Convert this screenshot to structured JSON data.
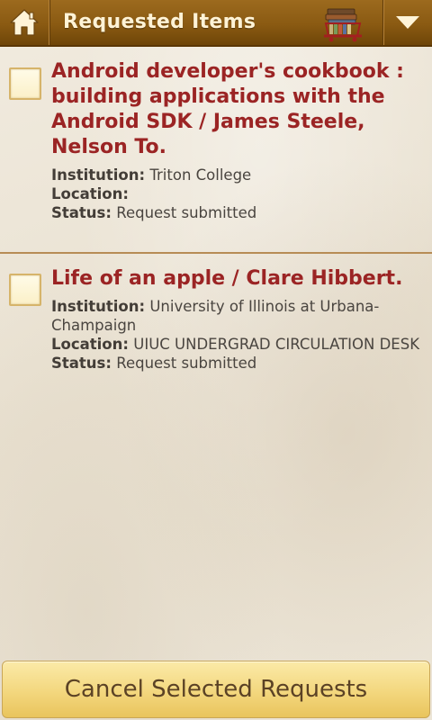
{
  "header": {
    "title": "Requested Items"
  },
  "items": [
    {
      "title": "Android developer's cookbook : building applications with the Android SDK / James Steele, Nelson To.",
      "institution_label": "Institution:",
      "institution": "Triton College",
      "location_label": "Location:",
      "location": "",
      "status_label": "Status:",
      "status": "Request submitted",
      "checked": false
    },
    {
      "title": "Life of an apple / Clare Hibbert.",
      "institution_label": "Institution:",
      "institution": "University of Illinois at Urbana-Champaign",
      "location_label": "Location:",
      "location": "UIUC UNDERGRAD CIRCULATION DESK",
      "status_label": "Status:",
      "status": "Request submitted",
      "checked": false
    }
  ],
  "footer": {
    "cancel_label": "Cancel Selected Requests"
  },
  "icons": {
    "home": "home-icon",
    "books": "books-icon",
    "menu": "dropdown-arrow-icon"
  },
  "colors": {
    "titlebar": "#8a5a12",
    "title_text": "#fff3d6",
    "item_title": "#9b2424",
    "button_bg": "#f3d77e"
  }
}
